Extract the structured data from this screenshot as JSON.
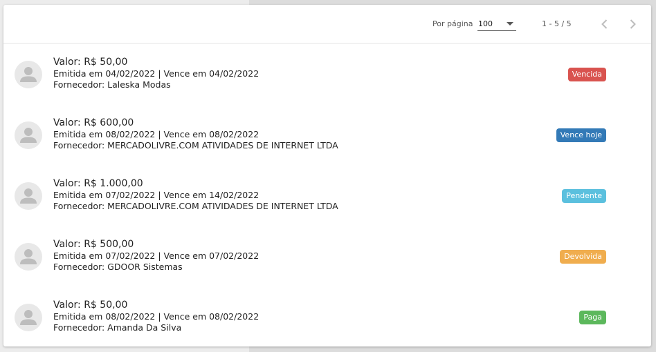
{
  "pagination": {
    "per_page_label": "Por página",
    "per_page_value": "100",
    "range_label": "1 - 5 / 5"
  },
  "icons": {
    "prev": "chevron-left-icon",
    "next": "chevron-right-icon",
    "avatar": "person-icon",
    "dropdown": "caret-down-icon"
  },
  "invoices": [
    {
      "value": "Valor: R$ 50,00",
      "dates": "Emitida em 04/02/2022 | Vence em 04/02/2022",
      "supplier": "Fornecedor: Laleska Modas",
      "status": "Vencida",
      "status_color": "#d9534f"
    },
    {
      "value": "Valor: R$ 600,00",
      "dates": "Emitida em 08/02/2022 | Vence em 08/02/2022",
      "supplier": "Fornecedor: MERCADOLIVRE.COM ATIVIDADES DE INTERNET LTDA",
      "status": "Vence hoje",
      "status_color": "#337ab7"
    },
    {
      "value": "Valor: R$ 1.000,00",
      "dates": "Emitida em 07/02/2022 | Vence em 14/02/2022",
      "supplier": "Fornecedor: MERCADOLIVRE.COM ATIVIDADES DE INTERNET LTDA",
      "status": "Pendente",
      "status_color": "#5bc0de"
    },
    {
      "value": "Valor: R$ 500,00",
      "dates": "Emitida em 07/02/2022 | Vence em 07/02/2022",
      "supplier": "Fornecedor: GDOOR Sistemas",
      "status": "Devolvida",
      "status_color": "#f0ad4e"
    },
    {
      "value": "Valor: R$ 50,00",
      "dates": "Emitida em 08/02/2022 | Vence em 08/02/2022",
      "supplier": "Fornecedor: Amanda Da Silva",
      "status": "Paga",
      "status_color": "#5cb85c"
    }
  ]
}
